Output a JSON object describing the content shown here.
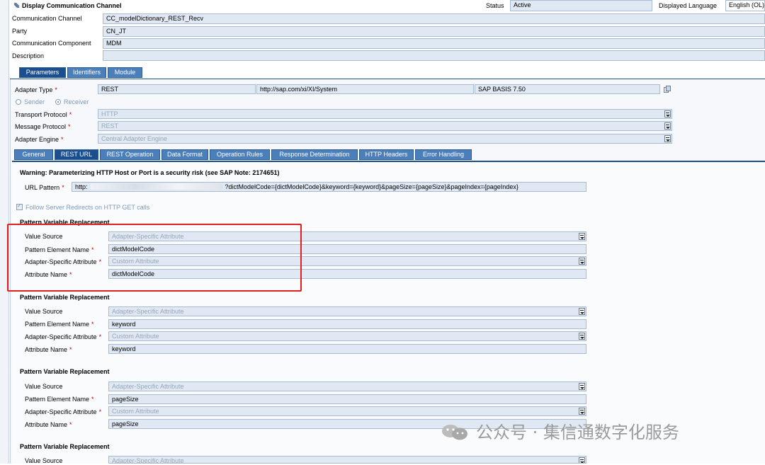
{
  "window": {
    "title": "Display Communication Channel"
  },
  "header": {
    "status_label": "Status",
    "status_value": "Active",
    "language_label": "Displayed Language",
    "language_value": "English (OL)",
    "channel_label": "Communication Channel",
    "channel_value": "CC_modelDictionary_REST_Recv",
    "party_label": "Party",
    "party_value": "CN_JT",
    "component_label": "Communication Component",
    "component_value": "MDM",
    "description_label": "Description",
    "description_value": ""
  },
  "main_tabs": [
    "Parameters",
    "Identifiers",
    "Module"
  ],
  "adapter": {
    "type_label": "Adapter Type",
    "type_value": "REST",
    "namespace": "http://sap.com/xi/XI/System",
    "basis": "SAP BASIS 7.50",
    "sender_label": "Sender",
    "receiver_label": "Receiver",
    "transport_label": "Transport Protocol",
    "transport_value": "HTTP",
    "message_label": "Message Protocol",
    "message_value": "REST",
    "engine_label": "Adapter Engine",
    "engine_value": "Central Adapter Engine"
  },
  "sub_tabs": [
    "General",
    "REST URL",
    "REST Operation",
    "Data Format",
    "Operation Rules",
    "Response Determination",
    "HTTP Headers",
    "Error Handling"
  ],
  "rest_url": {
    "warning": "Warning: Parameterizing HTTP Host or Port is a security risk (see SAP Note: 2174651)",
    "url_label": "URL Pattern",
    "url_prefix": "http:",
    "url_suffix": "?dictModelCode={dictModelCode}&keyword={keyword}&pageSize={pageSize}&pageIndex={pageIndex}",
    "follow_redirects": "Follow Server Redirects on HTTP GET calls"
  },
  "pattern_labels": {
    "section": "Pattern Variable Replacement",
    "value_source": "Value Source",
    "element_name": "Pattern Element Name",
    "adapter_attr": "Adapter-Specific Attribute",
    "attr_name": "Attribute Name"
  },
  "pattern_blocks": [
    {
      "value_source": "Adapter-Specific Attribute",
      "element_name": "dictModelCode",
      "adapter_attr": "Custom Attribute",
      "attr_name": "dictModelCode"
    },
    {
      "value_source": "Adapter-Specific Attribute",
      "element_name": "keyword",
      "adapter_attr": "Custom Attribute",
      "attr_name": "keyword"
    },
    {
      "value_source": "Adapter-Specific Attribute",
      "element_name": "pageSize",
      "adapter_attr": "Custom Attribute",
      "attr_name": "pageSize"
    },
    {
      "value_source": "Adapter-Specific Attribute"
    }
  ],
  "watermark": "公众号 · 集信通数字化服务",
  "colors": {
    "highlight": "#e02020",
    "field_bg": "#dfe8f3",
    "tab_bg": "#4a7fbc"
  }
}
